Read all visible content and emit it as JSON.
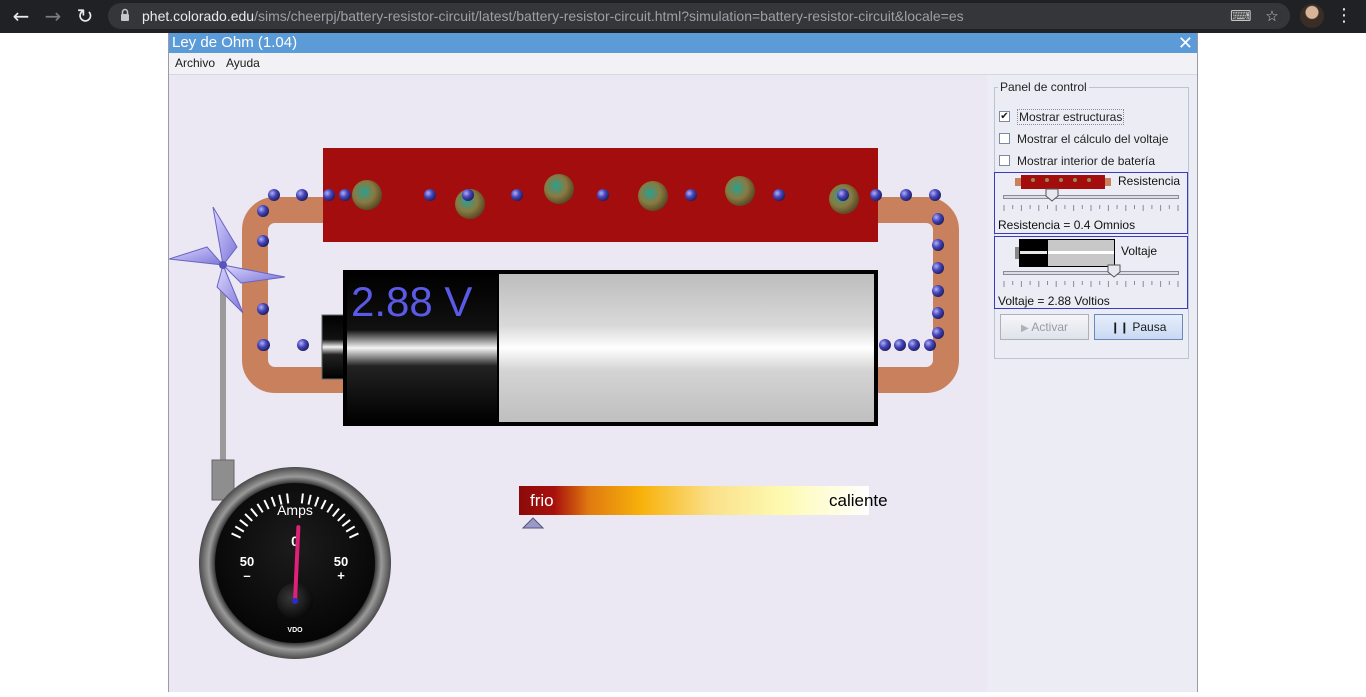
{
  "browser": {
    "url_host": "phet.colorado.edu",
    "url_path": "/sims/cheerpj/battery-resistor-circuit/latest/battery-resistor-circuit.html?simulation=battery-resistor-circuit&locale=es"
  },
  "app": {
    "title": "Ley de Ohm (1.04)",
    "menu": [
      "Archivo",
      "Ayuda"
    ]
  },
  "simulation": {
    "battery_voltage": "2.88 V",
    "ammeter": {
      "title": "Amps",
      "zero": "0",
      "left_value": "50",
      "left_sign": "–",
      "right_value": "50",
      "right_sign": "+",
      "brand": "VDO",
      "needle_value": 2
    },
    "thermometer": {
      "cold_label": "frio",
      "hot_label": "caliente",
      "level": 0.02
    }
  },
  "control_panel": {
    "title": "Panel de control",
    "checkboxes": [
      {
        "label": "Mostrar estructuras",
        "checked": true
      },
      {
        "label": "Mostrar el cálculo del voltaje",
        "checked": false
      },
      {
        "label": "Mostrar interior de batería",
        "checked": false
      }
    ],
    "resistance": {
      "name": "Resistencia",
      "caption": "Resistencia = 0.4 Omnios",
      "fraction": 0.28
    },
    "voltage": {
      "name": "Voltaje",
      "caption": "Voltaje = 2.88 Voltios",
      "fraction": 0.63
    },
    "buttons": {
      "play": "Activar",
      "pause": "Pausa"
    }
  },
  "colors": {
    "wire": "#c9815d",
    "resistor": "#a30d0d",
    "electron": "#4a4ab0",
    "voltage_text": "#5a5ae6",
    "needle": "#e0207a"
  }
}
